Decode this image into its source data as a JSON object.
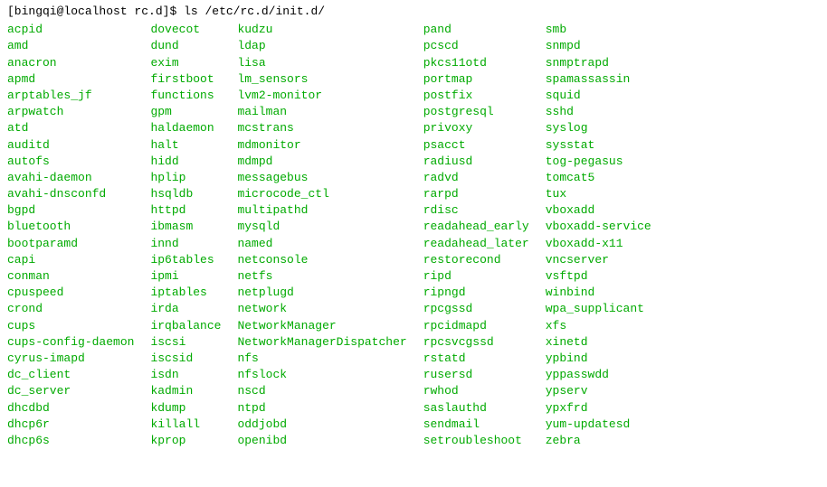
{
  "prompt": {
    "user_host_path": "[bingqi@localhost rc.d]",
    "symbol": "$",
    "command": "ls /etc/rc.d/init.d/"
  },
  "columns": [
    [
      "acpid",
      "amd",
      "anacron",
      "apmd",
      "arptables_jf",
      "arpwatch",
      "atd",
      "auditd",
      "autofs",
      "avahi-daemon",
      "avahi-dnsconfd",
      "bgpd",
      "bluetooth",
      "bootparamd",
      "capi",
      "conman",
      "cpuspeed",
      "crond",
      "cups",
      "cups-config-daemon",
      "cyrus-imapd",
      "dc_client",
      "dc_server",
      "dhcdbd",
      "dhcp6r",
      "dhcp6s"
    ],
    [
      "dovecot",
      "dund",
      "exim",
      "firstboot",
      "functions",
      "gpm",
      "haldaemon",
      "halt",
      "hidd",
      "hplip",
      "hsqldb",
      "httpd",
      "ibmasm",
      "innd",
      "ip6tables",
      "ipmi",
      "iptables",
      "irda",
      "irqbalance",
      "iscsi",
      "iscsid",
      "isdn",
      "kadmin",
      "kdump",
      "killall",
      "kprop"
    ],
    [
      "kudzu",
      "ldap",
      "lisa",
      "lm_sensors",
      "lvm2-monitor",
      "mailman",
      "mcstrans",
      "mdmonitor",
      "mdmpd",
      "messagebus",
      "microcode_ctl",
      "multipathd",
      "mysqld",
      "named",
      "netconsole",
      "netfs",
      "netplugd",
      "network",
      "NetworkManager",
      "NetworkManagerDispatcher",
      "nfs",
      "nfslock",
      "nscd",
      "ntpd",
      "oddjobd",
      "openibd"
    ],
    [
      "pand",
      "pcscd",
      "pkcs11otd",
      "portmap",
      "postfix",
      "postgresql",
      "privoxy",
      "psacct",
      "radiusd",
      "radvd",
      "rarpd",
      "rdisc",
      "readahead_early",
      "readahead_later",
      "restorecond",
      "ripd",
      "ripngd",
      "rpcgssd",
      "rpcidmapd",
      "rpcsvcgssd",
      "rstatd",
      "rusersd",
      "rwhod",
      "saslauthd",
      "sendmail",
      "setroubleshoot"
    ],
    [
      "smb",
      "snmpd",
      "snmptrapd",
      "spamassassin",
      "squid",
      "sshd",
      "syslog",
      "sysstat",
      "tog-pegasus",
      "tomcat5",
      "tux",
      "vboxadd",
      "vboxadd-service",
      "vboxadd-x11",
      "vncserver",
      "vsftpd",
      "winbind",
      "wpa_supplicant",
      "xfs",
      "xinetd",
      "ypbind",
      "yppasswdd",
      "ypserv",
      "ypxfrd",
      "yum-updatesd",
      "zebra"
    ]
  ]
}
